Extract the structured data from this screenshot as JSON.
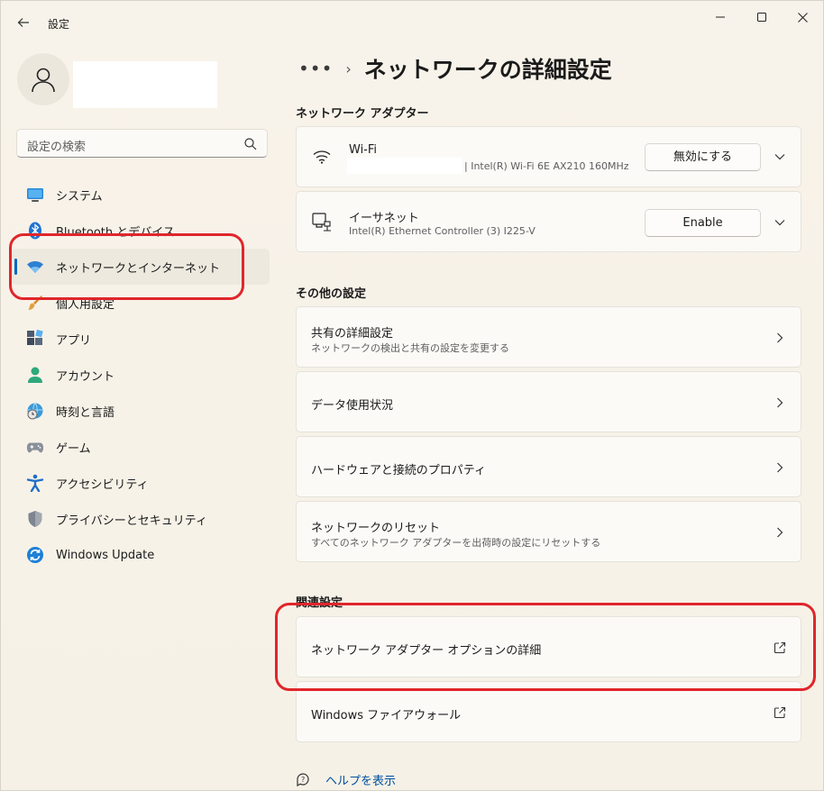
{
  "window": {
    "title": "設定",
    "controls": [
      "minimize",
      "maximize",
      "close"
    ]
  },
  "sidebar": {
    "search_placeholder": "設定の検索",
    "items": [
      {
        "label": "システム",
        "icon": "monitor-icon",
        "active": false
      },
      {
        "label": "Bluetooth とデバイス",
        "icon": "bluetooth-icon",
        "active": false
      },
      {
        "label": "ネットワークとインターネット",
        "icon": "wifi-icon",
        "active": true
      },
      {
        "label": "個人用設定",
        "icon": "brush-icon",
        "active": false
      },
      {
        "label": "アプリ",
        "icon": "apps-icon",
        "active": false
      },
      {
        "label": "アカウント",
        "icon": "person-icon",
        "active": false
      },
      {
        "label": "時刻と言語",
        "icon": "globe-clock-icon",
        "active": false
      },
      {
        "label": "ゲーム",
        "icon": "gamepad-icon",
        "active": false
      },
      {
        "label": "アクセシビリティ",
        "icon": "accessibility-icon",
        "active": false
      },
      {
        "label": "プライバシーとセキュリティ",
        "icon": "shield-icon",
        "active": false
      },
      {
        "label": "Windows Update",
        "icon": "update-icon",
        "active": false
      }
    ]
  },
  "breadcrumb": {
    "ellipsis": "•••",
    "separator": "›",
    "title": "ネットワークの詳細設定"
  },
  "adapters": {
    "heading": "ネットワーク アダプター",
    "items": [
      {
        "name": "Wi-Fi",
        "description": "| Intel(R) Wi-Fi 6E AX210 160MHz",
        "button": "無効にする",
        "icon": "wifi-icon"
      },
      {
        "name": "イーサネット",
        "description": "Intel(R) Ethernet Controller (3) I225-V",
        "button": "Enable",
        "icon": "ethernet-icon"
      }
    ]
  },
  "other": {
    "heading": "その他の設定",
    "items": [
      {
        "title": "共有の詳細設定",
        "subtitle": "ネットワークの検出と共有の設定を変更する"
      },
      {
        "title": "データ使用状況",
        "subtitle": ""
      },
      {
        "title": "ハードウェアと接続のプロパティ",
        "subtitle": ""
      },
      {
        "title": "ネットワークのリセット",
        "subtitle": "すべてのネットワーク アダプターを出荷時の設定にリセットする"
      }
    ]
  },
  "related": {
    "heading": "関連設定",
    "items": [
      {
        "title": "ネットワーク アダプター オプションの詳細"
      },
      {
        "title": "Windows ファイアウォール"
      }
    ]
  },
  "help": {
    "label": "ヘルプを表示"
  },
  "colors": {
    "accent": "#0067c0",
    "highlight_ring": "#e0262b",
    "background": "#f7f2e8"
  }
}
